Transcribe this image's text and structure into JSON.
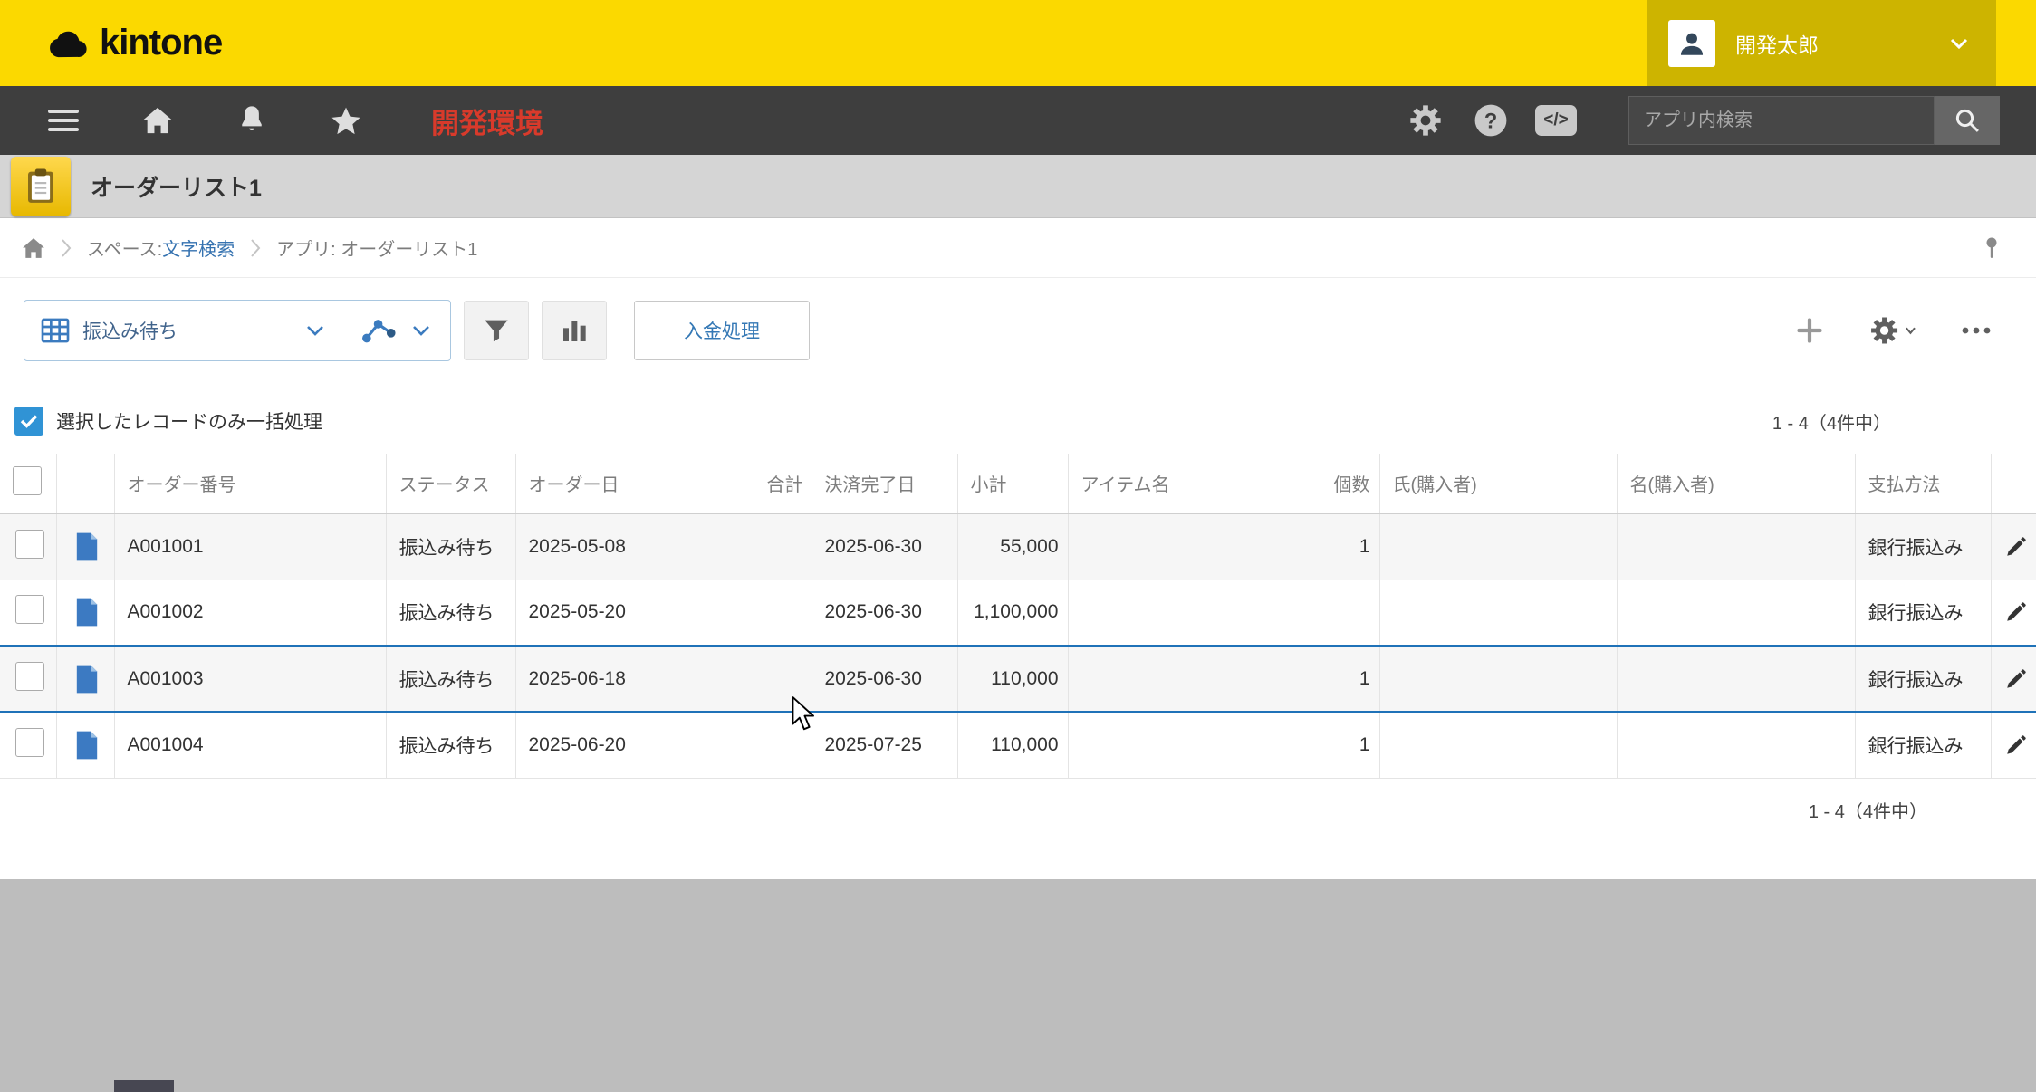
{
  "header": {
    "brand": "kintone",
    "user_name": "開発太郎"
  },
  "nav": {
    "env_label": "開発環境",
    "search_placeholder": "アプリ内検索"
  },
  "app": {
    "title": "オーダーリスト1"
  },
  "breadcrumb": {
    "space_prefix": "スペース: ",
    "space_link": "文字検索",
    "app_label": "アプリ: オーダーリスト1"
  },
  "toolbar": {
    "view_name": "振込み待ち",
    "process_button": "入金処理"
  },
  "bulk_bar": {
    "label": "選択したレコードのみ一括処理"
  },
  "pagination": {
    "label": "1 - 4（4件中）"
  },
  "table": {
    "headers": [
      "オーダー番号",
      "ステータス",
      "オーダー日",
      "合計",
      "決済完了日",
      "小計",
      "アイテム名",
      "個数",
      "氏(購入者)",
      "名(購入者)",
      "支払方法"
    ],
    "rows": [
      {
        "order_no": "A001001",
        "status": "振込み待ち",
        "order_date": "2025-05-08",
        "total": "",
        "settle_date": "2025-06-30",
        "subtotal": "55,000",
        "item_name": "",
        "qty": "1",
        "last_name": "",
        "first_name": "",
        "payment": "銀行振込み"
      },
      {
        "order_no": "A001002",
        "status": "振込み待ち",
        "order_date": "2025-05-20",
        "total": "",
        "settle_date": "2025-06-30",
        "subtotal": "1,100,000",
        "item_name": "",
        "qty": "",
        "last_name": "",
        "first_name": "",
        "payment": "銀行振込み"
      },
      {
        "order_no": "A001003",
        "status": "振込み待ち",
        "order_date": "2025-06-18",
        "total": "",
        "settle_date": "2025-06-30",
        "subtotal": "110,000",
        "item_name": "",
        "qty": "1",
        "last_name": "",
        "first_name": "",
        "payment": "銀行振込み"
      },
      {
        "order_no": "A001004",
        "status": "振込み待ち",
        "order_date": "2025-06-20",
        "total": "",
        "settle_date": "2025-07-25",
        "subtotal": "110,000",
        "item_name": "",
        "qty": "1",
        "last_name": "",
        "first_name": "",
        "payment": "銀行振込み"
      }
    ]
  },
  "colors": {
    "brand_yellow": "#fbd900",
    "user_box_yellow": "#cdb400",
    "nav_gray": "#3e3e3e",
    "env_red": "#d83a2b",
    "link_blue": "#3572b0",
    "accent_blue": "#3093d5",
    "row_highlight_border": "#1f72b8",
    "record_icon_blue": "#3c7ac2",
    "edit_pencil_yellow": "#d9a71a"
  }
}
